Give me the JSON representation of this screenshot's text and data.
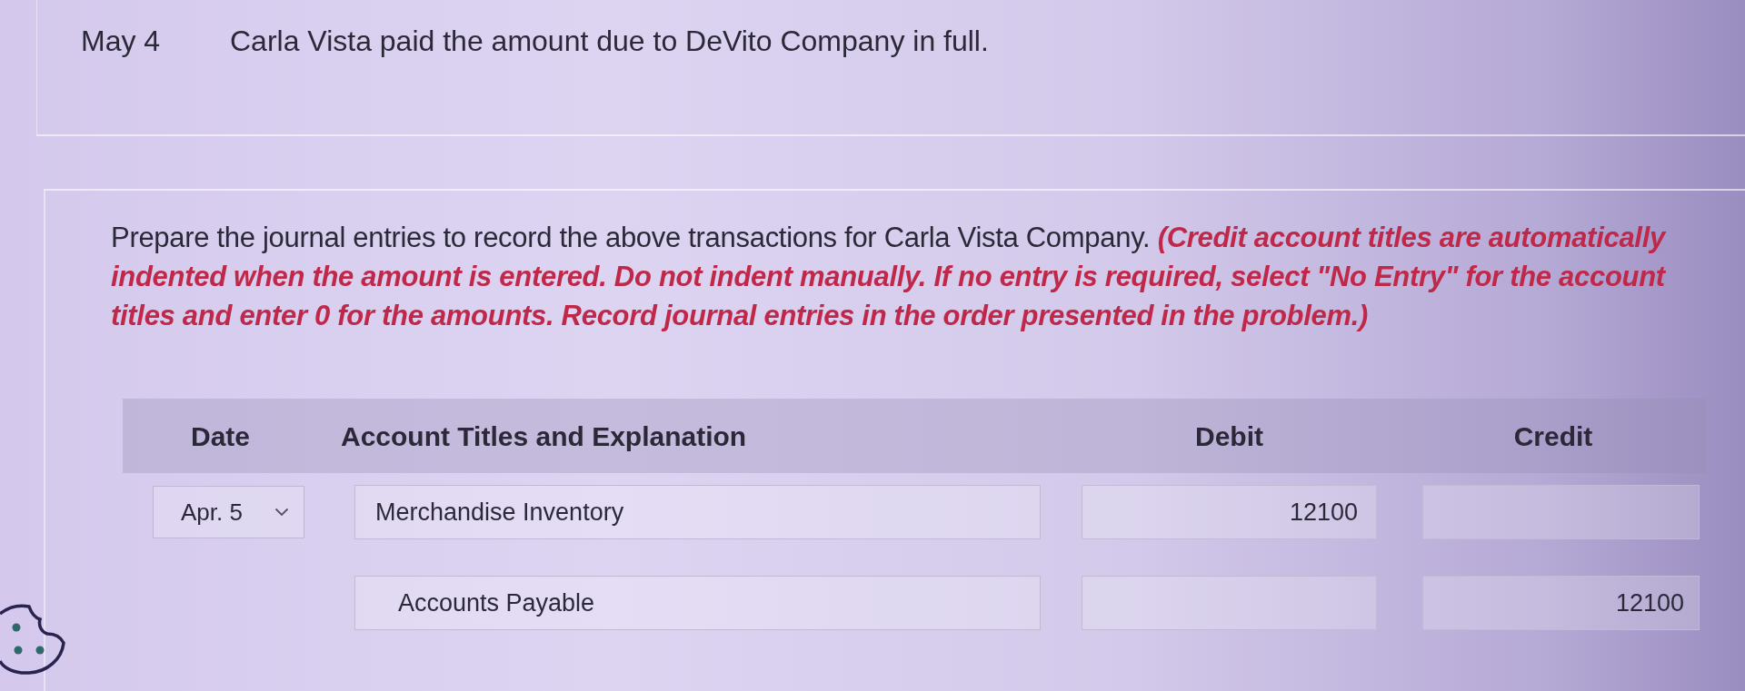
{
  "transaction": {
    "date": "May 4",
    "description": "Carla Vista paid the amount due to DeVito Company in full."
  },
  "instructions": "Prepare the journal entries to record the above transactions for Carla Vista Company. **(Credit account titles are automatically indented when the amount is entered. Do not indent manually. If no entry is required, select \"No Entry\" for the account titles and enter 0 for the amounts. Record journal entries in the order presented in the problem.)**",
  "table": {
    "columns": [
      "Date",
      "Account Titles and Explanation",
      "Debit",
      "Credit"
    ],
    "rows": [
      {
        "date": "Apr. 5",
        "account": "Merchandise Inventory",
        "indented": false,
        "debit": "12100"
      },
      {
        "account": "Accounts Payable",
        "indented": true,
        "credit": "12100"
      }
    ]
  }
}
